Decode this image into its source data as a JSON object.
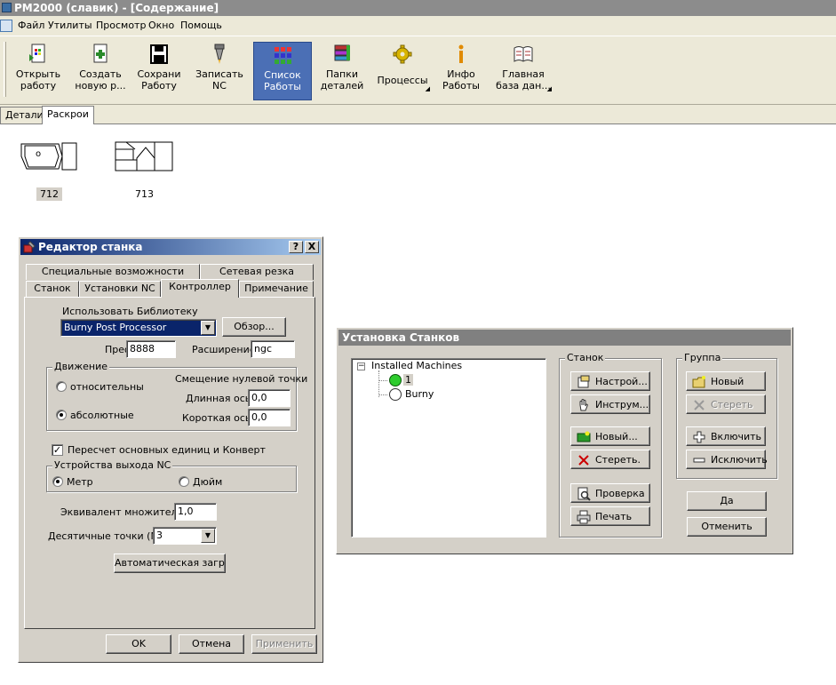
{
  "window": {
    "title": "PM2000 (славик) - [Содержание]"
  },
  "menu": [
    "Файл",
    "Утилиты",
    "Просмотр",
    "Окно",
    "Помощь"
  ],
  "toolbar": {
    "buttons": [
      {
        "label1": "Открыть",
        "label2": "работу",
        "icon": "open-work-icon"
      },
      {
        "label1": "Создать",
        "label2": "новую р...",
        "icon": "new-work-icon"
      },
      {
        "label1": "Сохрани",
        "label2": "Работу",
        "icon": "save-icon"
      },
      {
        "label1": "Записать",
        "label2": "NC",
        "icon": "write-nc-icon"
      },
      {
        "label1": "Список",
        "label2": "Работы",
        "icon": "job-list-icon",
        "active": true
      },
      {
        "label1": "Папки",
        "label2": "деталей",
        "icon": "part-folders-icon"
      },
      {
        "label1": "Процессы",
        "label2": "",
        "icon": "processes-icon"
      },
      {
        "label1": "Инфо",
        "label2": "Работы",
        "icon": "job-info-icon"
      },
      {
        "label1": "Главная",
        "label2": "база дан...",
        "icon": "main-database-icon"
      }
    ]
  },
  "doc_tabs": [
    "Детали",
    "Раскрои"
  ],
  "thumbnails": [
    {
      "label": "712"
    },
    {
      "label": "713"
    }
  ],
  "machine_editor": {
    "title": "Редактор станка",
    "help_glyph": "?",
    "close_glyph": "X",
    "tabs_back": [
      "Специальные возможности",
      "Сетевая резка"
    ],
    "tabs_front": [
      "Станок",
      "Установки NC",
      "Контроллер",
      "Примечание"
    ],
    "use_library_label": "Использовать Библиотеку",
    "library_value": "Burny Post Processor",
    "browse_button": "Обзор...",
    "prefix_label": "Префикс",
    "prefix_value": "8888",
    "extension_label": "Расширение",
    "extension_value": "ngc",
    "motion_group": "Движение",
    "relative_label": "относительны",
    "absolute_label": "абсолютные",
    "zero_offset_label": "Смещение нулевой точки",
    "long_axis_label": "Длинная ось",
    "long_axis_value": "0,0",
    "short_axis_label": "Короткая ось",
    "short_axis_value": "0,0",
    "recalc_label": "Пересчет основных единиц и Конверт",
    "nc_output_group": "Устройства выхода NC",
    "metric_label": "Метр",
    "inch_label": "Дюйм",
    "multiplier_label": "Эквивалент множителя",
    "multiplier_value": "1,0",
    "decimals_label": "Десятичные точки (NC",
    "decimals_value": "3",
    "autoload_button": "Автоматическая загрузк",
    "ok_button": "OK",
    "cancel_button": "Отмена",
    "apply_button": "Применить"
  },
  "machine_setup": {
    "title": "Установка Станков",
    "tree": {
      "root": "Installed Machines",
      "children": [
        "1",
        "Burny"
      ]
    },
    "machine_group": "Станок",
    "settings_button": "Настрой...",
    "tools_button": "Инструм...",
    "new_machine_button": "Новый...",
    "delete_machine_button": "Стереть.",
    "check_button": "Проверка",
    "print_button": "Печать",
    "group_group": "Группа",
    "new_group_button": "Новый",
    "delete_group_button": "Стереть",
    "include_button": "Включить",
    "exclude_button": "Исключить",
    "yes_button": "Да",
    "cancel_button": "Отменить"
  }
}
